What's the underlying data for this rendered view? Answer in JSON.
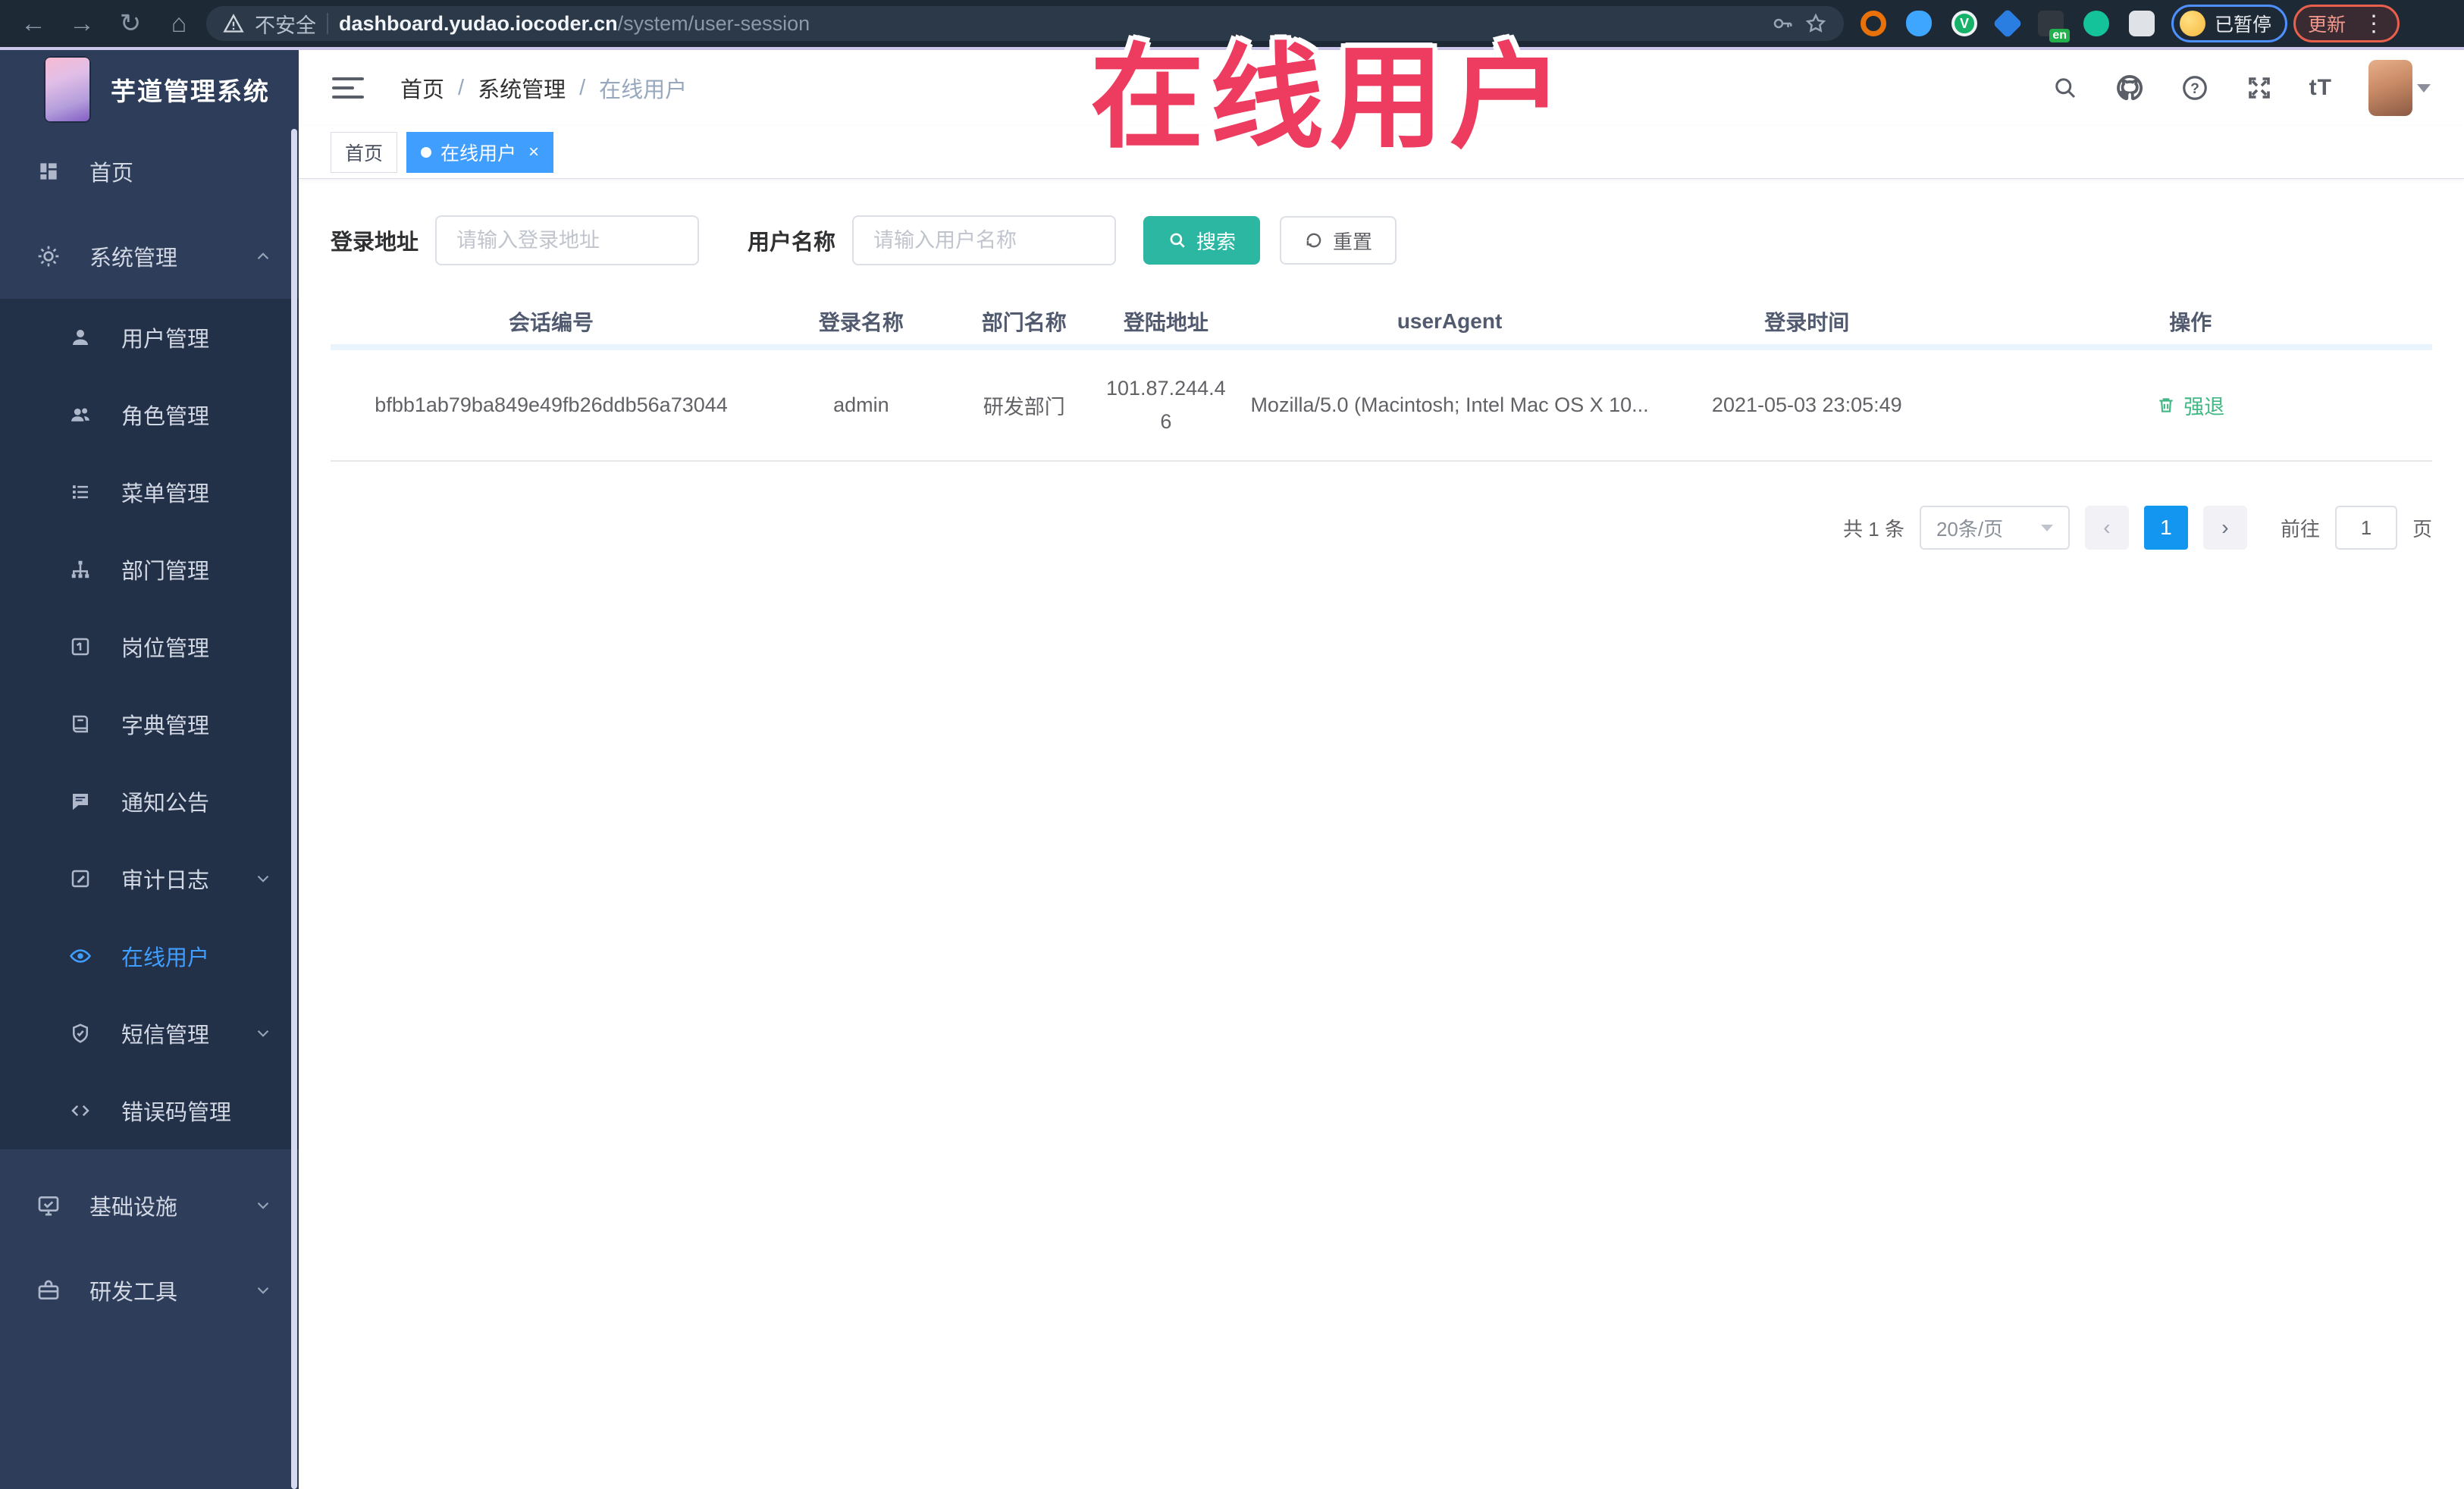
{
  "colors": {
    "primary": "#409eff",
    "search_button": "#2cb7a3",
    "action_green": "#41b883",
    "annotation_pink": "#ee3c60",
    "sidebar_bg": "#2e3d59",
    "submenu_bg": "#223048",
    "browser_bar": "#1e2936"
  },
  "browser": {
    "security_label": "不安全",
    "url_domain": "dashboard.yudao.iocoder.cn",
    "url_path": "/system/user-session",
    "ext_v_glyph": "V",
    "ext_en_glyph": "en",
    "paused_badge": "已暂停",
    "update_button": "更新"
  },
  "annotation": {
    "text": "在线用户"
  },
  "app": {
    "title": "芋道管理系统"
  },
  "header": {
    "font_size_glyph": "tT",
    "help_glyph": "?"
  },
  "breadcrumb": {
    "items": [
      {
        "label": "首页"
      },
      {
        "label": "系统管理"
      },
      {
        "label": "在线用户"
      }
    ],
    "separator": "/"
  },
  "tags": {
    "home": "首页",
    "active": "在线用户",
    "close_glyph": "×"
  },
  "filters": {
    "address_label": "登录地址",
    "address_placeholder": "请输入登录地址",
    "username_label": "用户名称",
    "username_placeholder": "请输入用户名称",
    "search_label": "搜索",
    "reset_label": "重置"
  },
  "table": {
    "headers": [
      "会话编号",
      "登录名称",
      "部门名称",
      "登陆地址",
      "userAgent",
      "登录时间",
      "操作"
    ],
    "rows": [
      {
        "session_id": "bfbb1ab79ba849e49fb26ddb56a73044",
        "username": "admin",
        "dept": "研发部门",
        "ip": "101.87.244.46",
        "user_agent": "Mozilla/5.0 (Macintosh; Intel Mac OS X 10...",
        "login_time": "2021-05-03 23:05:49",
        "action": "强退"
      }
    ]
  },
  "pagination": {
    "total": "共 1 条",
    "page_size": "20条/页",
    "prev_glyph": "‹",
    "next_glyph": "›",
    "current_page": "1",
    "goto_label": "前往",
    "goto_value": "1",
    "page_label": "页"
  },
  "sidebar": {
    "items": [
      {
        "label": "首页"
      },
      {
        "label": "系统管理"
      },
      {
        "label": "用户管理"
      },
      {
        "label": "角色管理"
      },
      {
        "label": "菜单管理"
      },
      {
        "label": "部门管理"
      },
      {
        "label": "岗位管理"
      },
      {
        "label": "字典管理"
      },
      {
        "label": "通知公告"
      },
      {
        "label": "审计日志"
      },
      {
        "label": "在线用户"
      },
      {
        "label": "短信管理"
      },
      {
        "label": "错误码管理"
      },
      {
        "label": "基础设施"
      },
      {
        "label": "研发工具"
      }
    ]
  }
}
